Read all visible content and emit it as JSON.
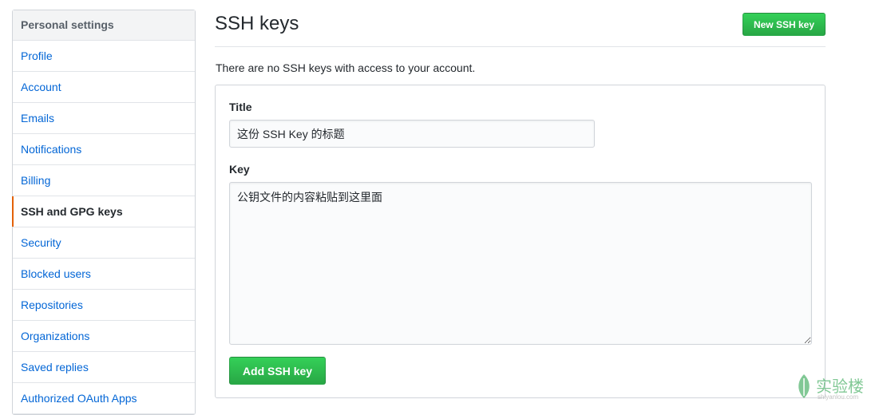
{
  "sidebar": {
    "header": "Personal settings",
    "items": [
      {
        "label": "Profile",
        "selected": false
      },
      {
        "label": "Account",
        "selected": false
      },
      {
        "label": "Emails",
        "selected": false
      },
      {
        "label": "Notifications",
        "selected": false
      },
      {
        "label": "Billing",
        "selected": false
      },
      {
        "label": "SSH and GPG keys",
        "selected": true
      },
      {
        "label": "Security",
        "selected": false
      },
      {
        "label": "Blocked users",
        "selected": false
      },
      {
        "label": "Repositories",
        "selected": false
      },
      {
        "label": "Organizations",
        "selected": false
      },
      {
        "label": "Saved replies",
        "selected": false
      },
      {
        "label": "Authorized OAuth Apps",
        "selected": false
      }
    ]
  },
  "main": {
    "title": "SSH keys",
    "new_key_button": "New SSH key",
    "no_keys_message": "There are no SSH keys with access to your account.",
    "form": {
      "title_label": "Title",
      "title_value": "这份 SSH Key 的标题",
      "key_label": "Key",
      "key_value": "公钥文件的内容粘贴到这里面",
      "submit_label": "Add SSH key"
    }
  },
  "watermark": {
    "text": "实验楼",
    "subtext": "shiyanlou.com"
  },
  "colors": {
    "link": "#0366d6",
    "selected_indicator": "#e36209",
    "button_green": "#28a745"
  }
}
